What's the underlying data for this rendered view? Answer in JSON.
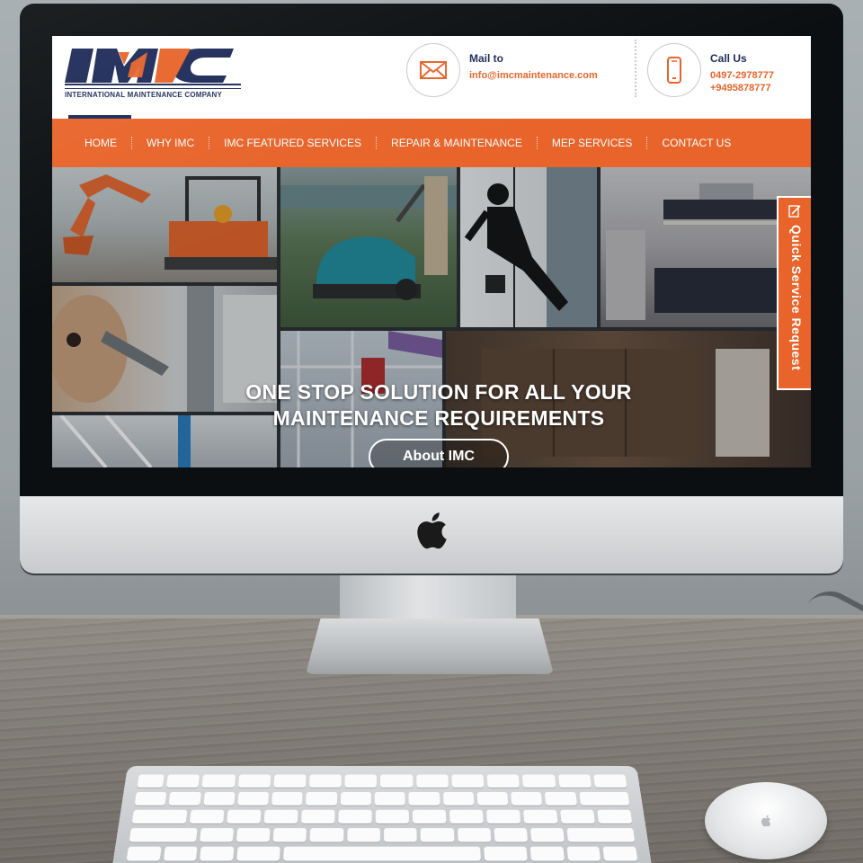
{
  "brand": {
    "logo_text": "IMC",
    "logo_subtitle": "INTERNATIONAL MAINTENANCE COMPANY",
    "colors": {
      "navy": "#1e2b58",
      "orange": "#e8642a"
    }
  },
  "contact": {
    "mail": {
      "title": "Mail to",
      "value": "info@imcmaintenance.com",
      "icon": "envelope-icon"
    },
    "phone": {
      "title": "Call Us",
      "lines": [
        "0497-2978777",
        "+9495878777"
      ],
      "icon": "mobile-phone-icon"
    }
  },
  "nav": {
    "items": [
      {
        "label": "HOME",
        "active": true
      },
      {
        "label": "WHY IMC"
      },
      {
        "label": "IMC FEATURED SERVICES"
      },
      {
        "label": "REPAIR & MAINTENANCE"
      },
      {
        "label": "MEP SERVICES"
      },
      {
        "label": "CONTACT US"
      }
    ]
  },
  "hero": {
    "headline_line1": "ONE STOP SOLUTION FOR ALL YOUR",
    "headline_line2": "MAINTENANCE REQUIREMENTS",
    "button_label": "About IMC"
  },
  "quick_service": {
    "label": "Quick Service Request",
    "icon": "edit-form-icon"
  },
  "device": {
    "logo_icon": "apple-logo-icon"
  }
}
